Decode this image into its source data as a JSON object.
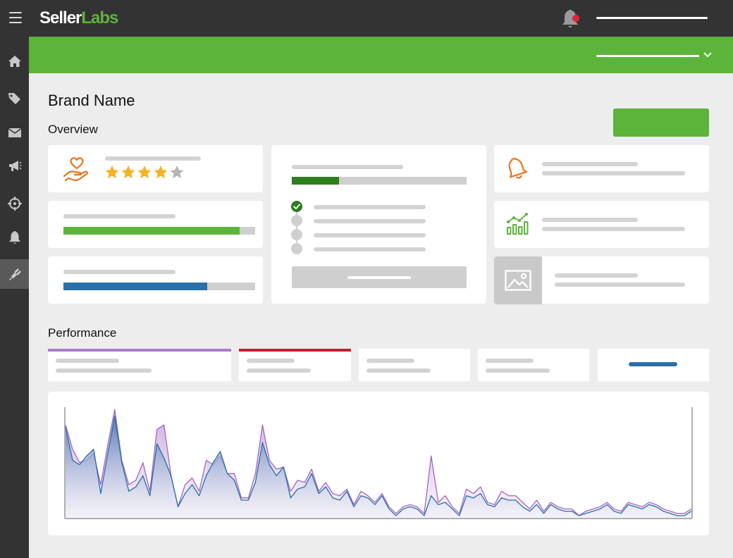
{
  "app": {
    "logo_part1": "Seller",
    "logo_part2": "Labs",
    "notification_dot_color": "#e8203a"
  },
  "sidebar": {
    "items": [
      {
        "icon": "home-icon"
      },
      {
        "icon": "tag-icon"
      },
      {
        "icon": "mail-icon"
      },
      {
        "icon": "megaphone-icon"
      },
      {
        "icon": "crosshair-icon"
      },
      {
        "icon": "bell-icon"
      },
      {
        "icon": "plugin-icon",
        "active": true
      }
    ]
  },
  "page": {
    "title": "Brand Name",
    "overview_heading": "Overview",
    "performance_heading": "Performance"
  },
  "overview": {
    "rating": {
      "stars_filled": 4,
      "stars_total": 5
    },
    "progress_green": 0.92,
    "progress_blue": 0.75,
    "checklist_progress": 0.27,
    "checklist_steps": [
      true,
      false,
      false,
      false
    ]
  },
  "colors": {
    "brand_green": "#5cb43a",
    "dark_green": "#2e7d1e",
    "blue": "#2a6fa8",
    "purple": "#a97bc7",
    "red": "#c21f33",
    "orange": "#e8731c"
  },
  "chart_data": {
    "type": "area",
    "x": [
      0,
      1,
      2,
      3,
      4,
      5,
      6,
      7,
      8,
      9,
      10,
      11,
      12,
      13,
      14,
      15,
      16,
      17,
      18,
      19,
      20,
      21,
      22,
      23,
      24,
      25,
      26,
      27,
      28,
      29,
      30,
      31,
      32,
      33,
      34,
      35,
      36,
      37,
      38,
      39,
      40,
      41,
      42,
      43,
      44,
      45,
      46,
      47,
      48,
      49,
      50,
      51,
      52,
      53,
      54,
      55,
      56,
      57,
      58,
      59,
      60,
      61,
      62,
      63,
      64,
      65,
      66,
      67,
      68,
      69,
      70,
      71,
      72,
      73,
      74,
      75,
      76,
      77,
      78,
      79,
      80,
      81,
      82,
      83,
      84,
      85,
      86,
      87,
      88,
      89
    ],
    "series": [
      {
        "values": [
          84,
          62,
          50,
          52,
          58,
          30,
          66,
          98,
          52,
          30,
          34,
          50,
          24,
          80,
          84,
          38,
          10,
          30,
          36,
          24,
          52,
          48,
          56,
          40,
          40,
          18,
          18,
          40,
          84,
          52,
          44,
          46,
          24,
          34,
          32,
          44,
          24,
          32,
          22,
          20,
          26,
          12,
          24,
          20,
          14,
          22,
          10,
          4,
          10,
          12,
          10,
          4,
          56,
          14,
          20,
          10,
          4,
          26,
          22,
          28,
          14,
          12,
          24,
          20,
          20,
          14,
          8,
          16,
          6,
          14,
          10,
          8,
          8,
          2,
          6,
          8,
          10,
          14,
          8,
          6,
          14,
          12,
          10,
          14,
          12,
          8,
          6,
          4,
          4,
          8
        ]
      },
      {
        "values": [
          82,
          52,
          48,
          56,
          62,
          22,
          58,
          92,
          50,
          24,
          28,
          38,
          20,
          67,
          54,
          38,
          10,
          22,
          30,
          20,
          38,
          50,
          60,
          40,
          34,
          16,
          16,
          32,
          68,
          48,
          38,
          46,
          18,
          26,
          28,
          40,
          22,
          28,
          18,
          16,
          24,
          10,
          20,
          18,
          12,
          20,
          8,
          2,
          8,
          10,
          8,
          2,
          20,
          12,
          14,
          8,
          2,
          20,
          18,
          22,
          12,
          10,
          18,
          16,
          16,
          10,
          6,
          12,
          4,
          12,
          8,
          6,
          6,
          2,
          4,
          6,
          8,
          12,
          6,
          4,
          12,
          10,
          8,
          12,
          10,
          6,
          4,
          2,
          2,
          6
        ]
      }
    ],
    "ylim": [
      0,
      100
    ]
  }
}
